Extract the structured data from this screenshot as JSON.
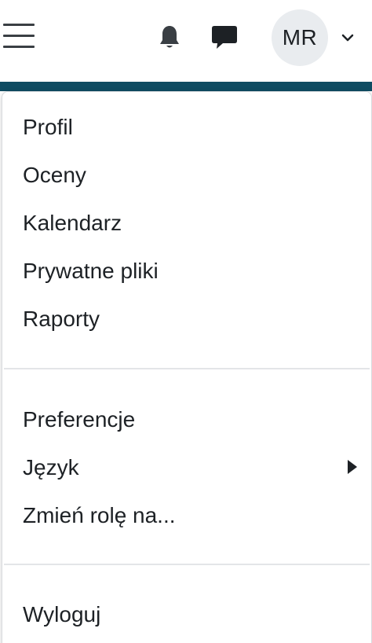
{
  "header": {
    "user_initials": "MR"
  },
  "icons": {
    "menu": "hamburger-menu-icon",
    "notifications": "bell-icon",
    "messages": "chat-bubble-icon",
    "user_menu_toggle": "chevron-down-icon",
    "submenu": "caret-right-icon"
  },
  "colors": {
    "brand_strip": "#0f4c62",
    "avatar_bg": "#e9ecef",
    "text": "#1d2125",
    "icon": "#3a3f44",
    "divider": "#e3e5e8"
  },
  "menu": {
    "group1": [
      "Profil",
      "Oceny",
      "Kalendarz",
      "Prywatne pliki",
      "Raporty"
    ],
    "group2": [
      "Preferencje",
      "Język",
      "Zmień rolę na..."
    ],
    "group3": [
      "Wyloguj"
    ]
  }
}
